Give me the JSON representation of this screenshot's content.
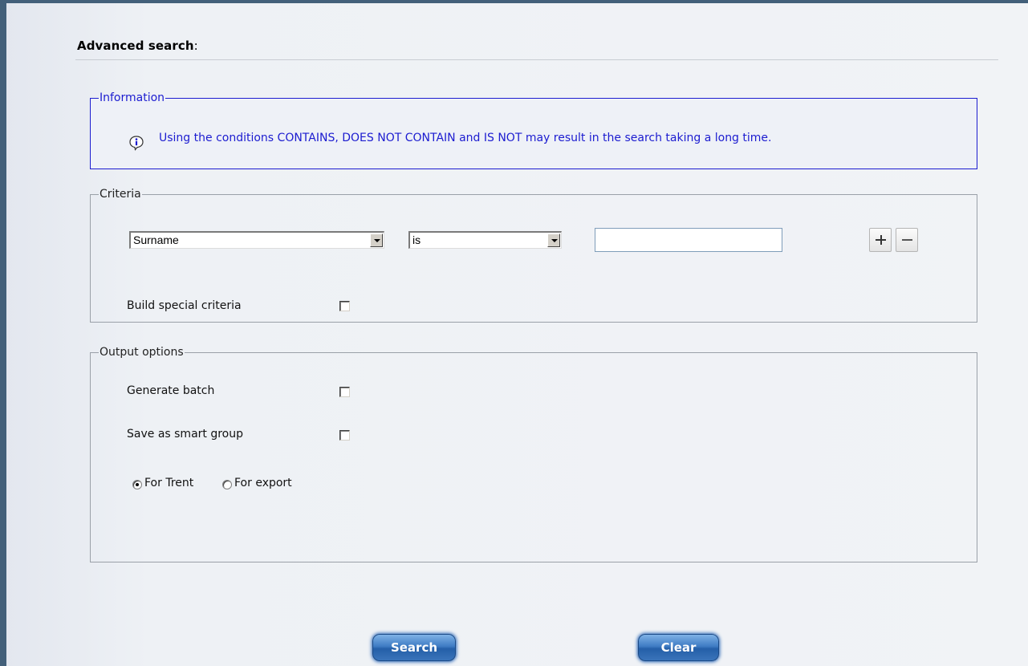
{
  "page": {
    "title": "Advanced search",
    "title_suffix": ":"
  },
  "information": {
    "legend": "Information",
    "icon": "info-icon",
    "text": "Using the conditions CONTAINS, DOES NOT CONTAIN and IS NOT may result in the search taking a long time.",
    "color": "#1c1cd0"
  },
  "criteria": {
    "legend": "Criteria",
    "field_select": {
      "value": "Surname"
    },
    "operator_select": {
      "value": "is"
    },
    "value_input": {
      "value": ""
    },
    "add_button": "plus-icon",
    "remove_button": "minus-icon",
    "special_criteria": {
      "label": "Build special criteria",
      "checked": false
    }
  },
  "output_options": {
    "legend": "Output options",
    "generate_batch": {
      "label": "Generate batch",
      "checked": false
    },
    "save_smart_group": {
      "label": "Save as smart group",
      "checked": false
    },
    "target": {
      "options": [
        {
          "label": "For Trent",
          "checked": true
        },
        {
          "label": "For export",
          "checked": false
        }
      ]
    }
  },
  "actions": {
    "search_label": "Search",
    "clear_label": "Clear",
    "accent": "#2a67b8"
  }
}
